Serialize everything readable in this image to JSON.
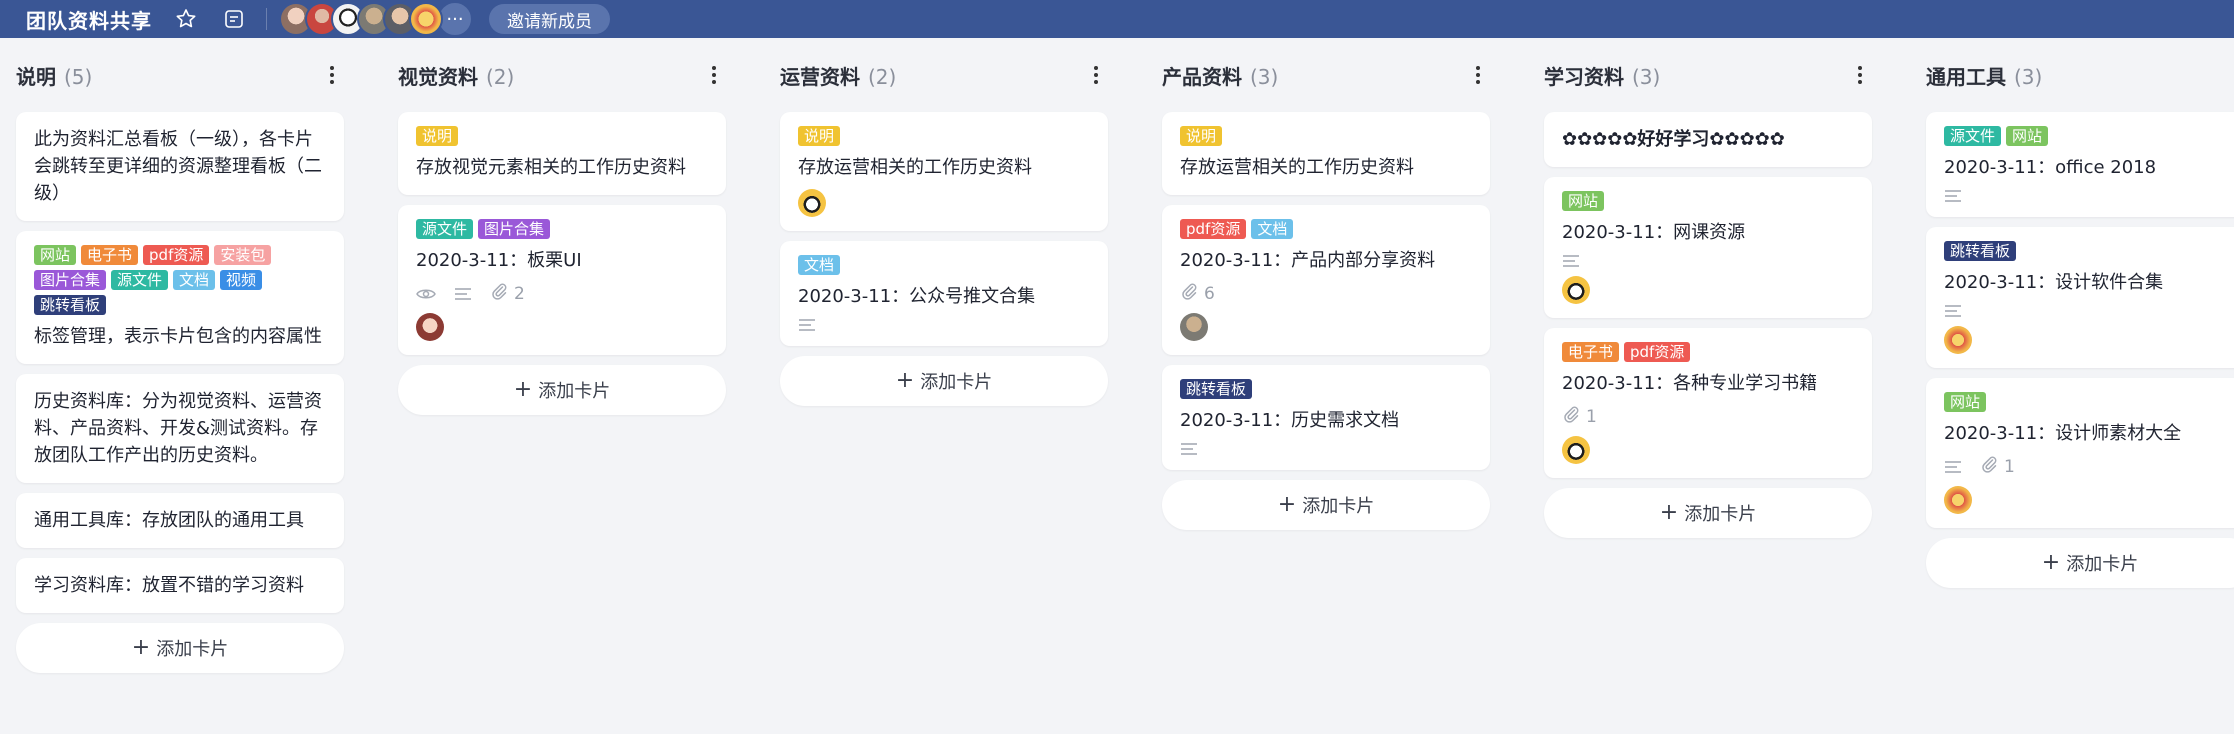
{
  "header": {
    "title": "团队资料共享",
    "invite_label": "邀请新成员",
    "more_members": "···"
  },
  "colors": {
    "topbar": "#3a5695",
    "tag_green": "#7cc45f",
    "tag_orange": "#f08a3a",
    "tag_red": "#ee5a52",
    "tag_pink": "#f6a2a2",
    "tag_purple": "#9a58d8",
    "tag_teal": "#2eb9a2",
    "tag_lightblue": "#6cc0ea",
    "tag_blue": "#3a8ee6",
    "tag_navy": "#2f3f7a",
    "tag_yellow": "#f0c330"
  },
  "add_card_label": "添加卡片",
  "columns": [
    {
      "title": "说明",
      "count": "(5)",
      "cards": [
        {
          "text": "此为资料汇总看板（一级），各卡片会跳转至更详细的资源整理看板（二级）"
        },
        {
          "tags": [
            {
              "label": "网站",
              "color": "#7cc45f"
            },
            {
              "label": "电子书",
              "color": "#f08a3a"
            },
            {
              "label": "pdf资源",
              "color": "#ee5a52"
            },
            {
              "label": "安装包",
              "color": "#f6a2a2"
            },
            {
              "label": "图片合集",
              "color": "#9a58d8"
            },
            {
              "label": "源文件",
              "color": "#2eb9a2"
            },
            {
              "label": "文档",
              "color": "#6cc0ea"
            },
            {
              "label": "视频",
              "color": "#3a8ee6"
            },
            {
              "label": "跳转看板",
              "color": "#2f3f7a"
            }
          ],
          "text": "标签管理，表示卡片包含的内容属性"
        },
        {
          "text": "历史资料库：分为视觉资料、运营资料、产品资料、开发&测试资料。存放团队工作产出的历史资料。"
        },
        {
          "text": "通用工具库：存放团队的通用工具"
        },
        {
          "text": "学习资料库：放置不错的学习资料"
        }
      ]
    },
    {
      "title": "视觉资料",
      "count": "(2)",
      "cards": [
        {
          "tags": [
            {
              "label": "说明",
              "color": "#f0c330"
            }
          ],
          "text": "存放视觉元素相关的工作历史资料"
        },
        {
          "tags": [
            {
              "label": "源文件",
              "color": "#2eb9a2"
            },
            {
              "label": "图片合集",
              "color": "#9a58d8"
            }
          ],
          "text": "2020-3-11：板栗UI",
          "meta": {
            "eye": true,
            "desc": true,
            "attach": "2"
          },
          "avatar": "girl"
        }
      ]
    },
    {
      "title": "运营资料",
      "count": "(2)",
      "cards": [
        {
          "tags": [
            {
              "label": "说明",
              "color": "#f0c330"
            }
          ],
          "text": "存放运营相关的工作历史资料",
          "avatar": "cap"
        },
        {
          "tags": [
            {
              "label": "文档",
              "color": "#6cc0ea"
            }
          ],
          "text": "2020-3-11：公众号推文合集",
          "meta": {
            "desc": true
          }
        }
      ]
    },
    {
      "title": "产品资料",
      "count": "(3)",
      "cards": [
        {
          "tags": [
            {
              "label": "说明",
              "color": "#f0c330"
            }
          ],
          "text": "存放运营相关的工作历史资料"
        },
        {
          "tags": [
            {
              "label": "pdf资源",
              "color": "#ee5a52"
            },
            {
              "label": "文档",
              "color": "#6cc0ea"
            }
          ],
          "text": "2020-3-11：产品内部分享资料",
          "meta": {
            "attach": "6"
          },
          "avatar": "man"
        },
        {
          "tags": [
            {
              "label": "跳转看板",
              "color": "#2f3f7a"
            }
          ],
          "text": "2020-3-11：历史需求文档",
          "meta": {
            "desc": true
          }
        }
      ]
    },
    {
      "title": "学习资料",
      "count": "(3)",
      "cards": [
        {
          "text": "✿✿✿✿✿好好学习✿✿✿✿✿",
          "bold": true
        },
        {
          "tags": [
            {
              "label": "网站",
              "color": "#7cc45f"
            }
          ],
          "text": "2020-3-11：网课资源",
          "meta": {
            "desc": true
          },
          "avatar": "cap"
        },
        {
          "tags": [
            {
              "label": "电子书",
              "color": "#f08a3a"
            },
            {
              "label": "pdf资源",
              "color": "#ee5a52"
            }
          ],
          "text": "2020-3-11：各种专业学习书籍",
          "meta": {
            "attach": "1"
          },
          "avatar": "cap"
        }
      ]
    },
    {
      "title": "通用工具",
      "count": "(3)",
      "cards": [
        {
          "tags": [
            {
              "label": "源文件",
              "color": "#2eb9a2"
            },
            {
              "label": "网站",
              "color": "#7cc45f"
            }
          ],
          "text": "2020-3-11：office 2018",
          "meta": {
            "desc": true
          }
        },
        {
          "tags": [
            {
              "label": "跳转看板",
              "color": "#2f3f7a"
            }
          ],
          "text": "2020-3-11：设计软件合集",
          "meta": {
            "desc": true
          },
          "avatar": "yellow"
        },
        {
          "tags": [
            {
              "label": "网站",
              "color": "#7cc45f"
            }
          ],
          "text": "2020-3-11：设计师素材大全",
          "meta": {
            "desc": true,
            "attach": "1"
          },
          "avatar": "yellow"
        }
      ]
    }
  ]
}
